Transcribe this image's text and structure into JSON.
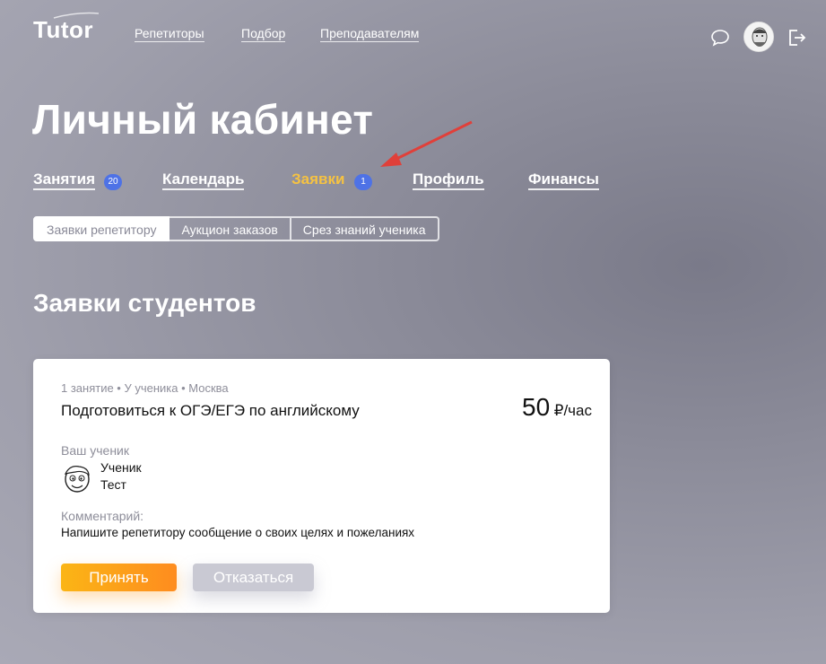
{
  "header": {
    "logo": "Tutor",
    "nav": [
      {
        "label": "Репетиторы"
      },
      {
        "label": "Подбор"
      },
      {
        "label": "Преподавателям"
      }
    ]
  },
  "page": {
    "title": "Личный кабинет",
    "tabs": [
      {
        "label": "Занятия",
        "badge": "20"
      },
      {
        "label": "Календарь"
      },
      {
        "label": "Заявки",
        "badge": "1",
        "active": true
      },
      {
        "label": "Профиль"
      },
      {
        "label": "Финансы"
      }
    ],
    "subtabs": [
      {
        "label": "Заявки репетитору",
        "active": true
      },
      {
        "label": "Аукцион заказов"
      },
      {
        "label": "Срез знаний ученика"
      }
    ],
    "section_title": "Заявки студентов"
  },
  "request": {
    "meta": "1 занятие • У ученика • Москва",
    "title": "Подготовиться к ОГЭ/ЕГЭ по английскому",
    "price_value": "50",
    "price_unit": "₽/час",
    "student_label": "Ваш ученик",
    "student_first": "Ученик",
    "student_last": "Тест",
    "comment_label": "Комментарий:",
    "comment": "Напишите репетитору сообщение о своих целях и пожеланиях",
    "accept_label": "Принять",
    "decline_label": "Отказаться"
  },
  "colors": {
    "active_tab": "#f5c242",
    "badge": "#4e72e6",
    "accept_start": "#fbb515",
    "accept_end": "#fe8c1f",
    "decline": "#c9c9d3",
    "annotation_arrow": "#e0403a"
  },
  "icons": [
    "chat-icon",
    "avatar",
    "logout-icon",
    "annotation-arrow",
    "student-avatar-icon"
  ]
}
